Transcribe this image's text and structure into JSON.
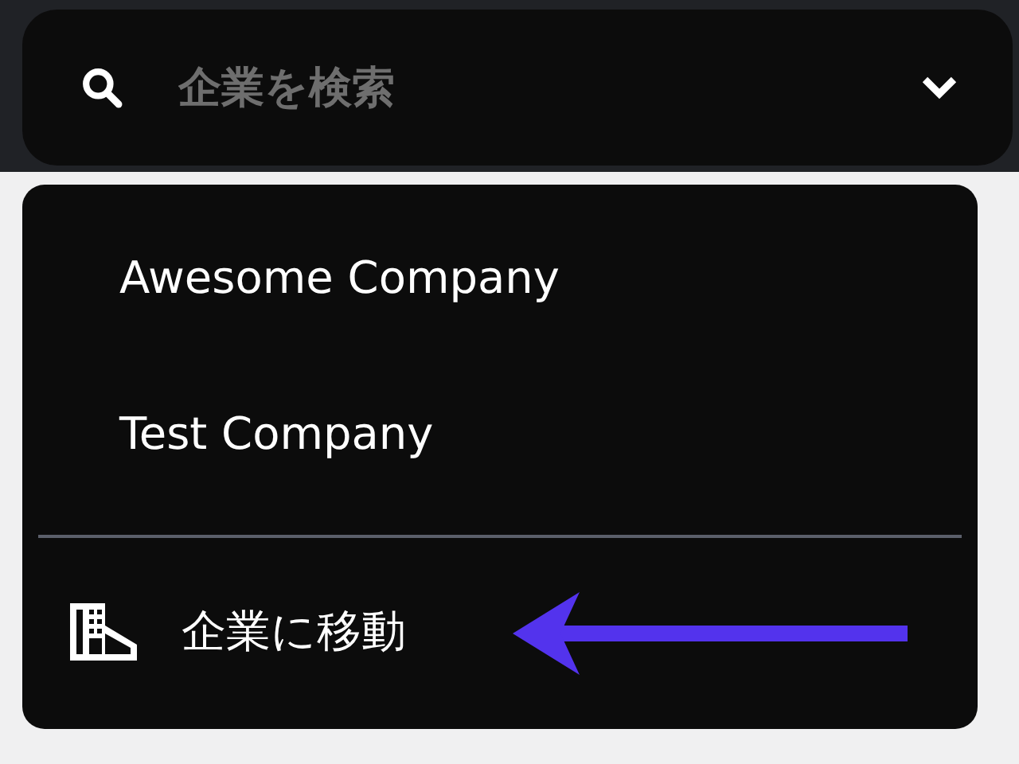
{
  "search": {
    "placeholder": "企業を検索"
  },
  "options": [
    {
      "label": "Awesome Company"
    },
    {
      "label": "Test Company"
    }
  ],
  "action": {
    "label": "企業に移動"
  }
}
